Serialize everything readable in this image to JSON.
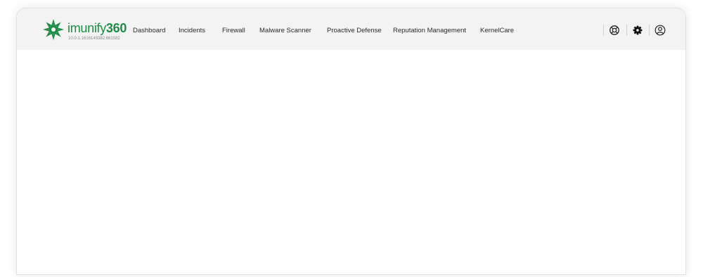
{
  "app": {
    "brand_name": "imunify",
    "brand_number": "360",
    "version": "10.0-1.1616149382.661582",
    "brand_color": "#1e8e46"
  },
  "nav": {
    "items": [
      {
        "label": "Dashboard"
      },
      {
        "label": "Incidents"
      },
      {
        "label": "Firewall"
      },
      {
        "label": "Malware Scanner"
      },
      {
        "label": "Proactive Defense"
      },
      {
        "label": "Reputation Management"
      },
      {
        "label": "KernelCare"
      }
    ]
  },
  "toolbar": {
    "icons": [
      "support-icon",
      "gear-icon",
      "user-icon"
    ]
  }
}
